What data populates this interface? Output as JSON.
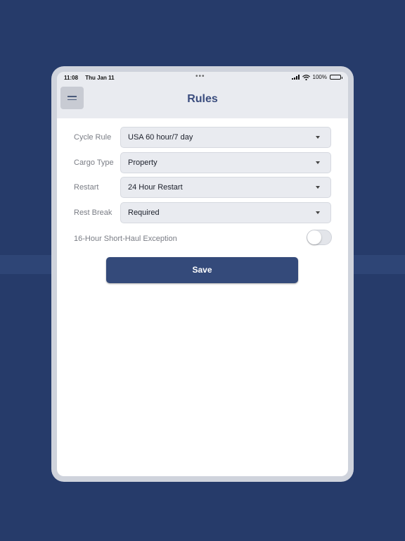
{
  "status_bar": {
    "time": "11:08",
    "date": "Thu Jan 11",
    "dots": "•••",
    "battery": "100%"
  },
  "nav": {
    "title": "Rules"
  },
  "form": {
    "fields": [
      {
        "label": "Cycle Rule",
        "value": "USA 60 hour/7 day"
      },
      {
        "label": "Cargo Type",
        "value": "Property"
      },
      {
        "label": "Restart",
        "value": "24 Hour Restart"
      },
      {
        "label": "Rest Break",
        "value": "Required"
      }
    ],
    "toggle": {
      "label": "16-Hour Short-Haul Exception",
      "enabled": false
    },
    "save_label": "Save"
  },
  "colors": {
    "background": "#263b6a",
    "accent": "#344a7a",
    "title": "#3b4d7e"
  }
}
